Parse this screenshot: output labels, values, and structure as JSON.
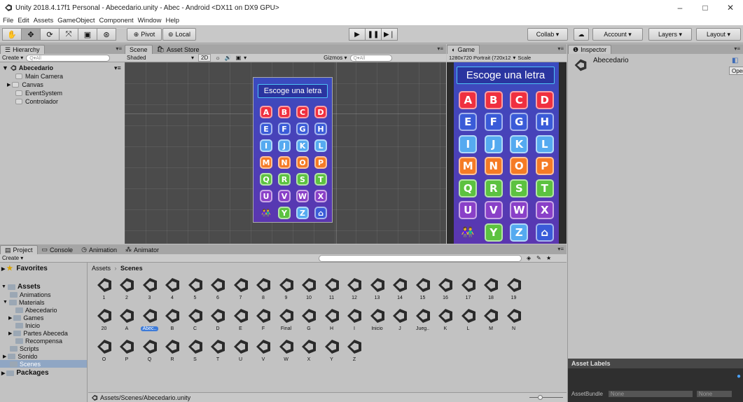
{
  "window": {
    "title": "Unity 2018.4.17f1 Personal - Abecedario.unity - Abec - Android <DX11 on DX9 GPU>",
    "minimize": "–",
    "maximize": "□",
    "close": "✕"
  },
  "menu": [
    "File",
    "Edit",
    "Assets",
    "GameObject",
    "Component",
    "Window",
    "Help"
  ],
  "toolbar": {
    "pivot": "Pivot",
    "local": "Local",
    "collab": "Collab ▾",
    "account": "Account ▾",
    "layers": "Layers ▾",
    "layout": "Layout ▾"
  },
  "hierarchy": {
    "tab": "Hierarchy",
    "create": "Create ▾",
    "search": "Q▾All",
    "scene": "Abecedario",
    "items": [
      "Main Camera",
      "Canvas",
      "EventSystem",
      "Controlador"
    ]
  },
  "scene_panel": {
    "tabs": [
      "Scene",
      "Asset Store"
    ],
    "shaded": "Shaded",
    "mode2d": "2D",
    "gizmos": "Gizmos ▾",
    "search": "Q▾All"
  },
  "game_panel": {
    "tab": "Game",
    "resolution": "1280x720 Portrait (720x12",
    "scale": "Scale"
  },
  "app_screen": {
    "title": "Escoge una letra",
    "letters": [
      "A",
      "B",
      "C",
      "D",
      "E",
      "F",
      "G",
      "H",
      "I",
      "J",
      "K",
      "L",
      "M",
      "N",
      "O",
      "P",
      "Q",
      "R",
      "S",
      "T",
      "U",
      "V",
      "W",
      "X",
      "",
      "Y",
      "Z",
      ""
    ],
    "colors": {
      "red": "#f0303f",
      "blue": "#3a5bd8",
      "light_blue": "#55aaf0",
      "orange": "#f57b25",
      "green": "#5cc240",
      "purple": "#8a40c8",
      "background": "#4a3fbf"
    }
  },
  "inspector": {
    "tab": "Inspector",
    "object": "Abecedario",
    "open": "Open",
    "asset_labels": "Asset Labels",
    "assetbundle": "AssetBundle",
    "none": "None"
  },
  "project": {
    "tabs": [
      "Project",
      "Console",
      "Animation",
      "Animator"
    ],
    "create": "Create ▾",
    "favorites": "Favorites",
    "assets": "Assets",
    "packages": "Packages",
    "tree": [
      "Animations",
      "Materials",
      "Abecedario",
      "Games",
      "Inicio",
      "Partes Abeceda",
      "Recompensa",
      "Scripts",
      "Sonido",
      "Scenes"
    ],
    "breadcrumb": [
      "Assets",
      "Scenes"
    ],
    "row1": [
      "1",
      "2",
      "3",
      "4",
      "5",
      "6",
      "7",
      "8",
      "9",
      "10",
      "11",
      "12",
      "13",
      "14",
      "15",
      "16",
      "17",
      "18",
      "19"
    ],
    "row2": [
      "20",
      "A",
      "Abec..",
      "B",
      "C",
      "D",
      "E",
      "F",
      "Final",
      "G",
      "H",
      "I",
      "Inicio",
      "J",
      "Jueg..",
      "K",
      "L",
      "M",
      "N"
    ],
    "row3": [
      "O",
      "P",
      "Q",
      "R",
      "S",
      "T",
      "U",
      "V",
      "W",
      "X",
      "Y",
      "Z"
    ],
    "path": "Assets/Scenes/Abecedario.unity"
  }
}
